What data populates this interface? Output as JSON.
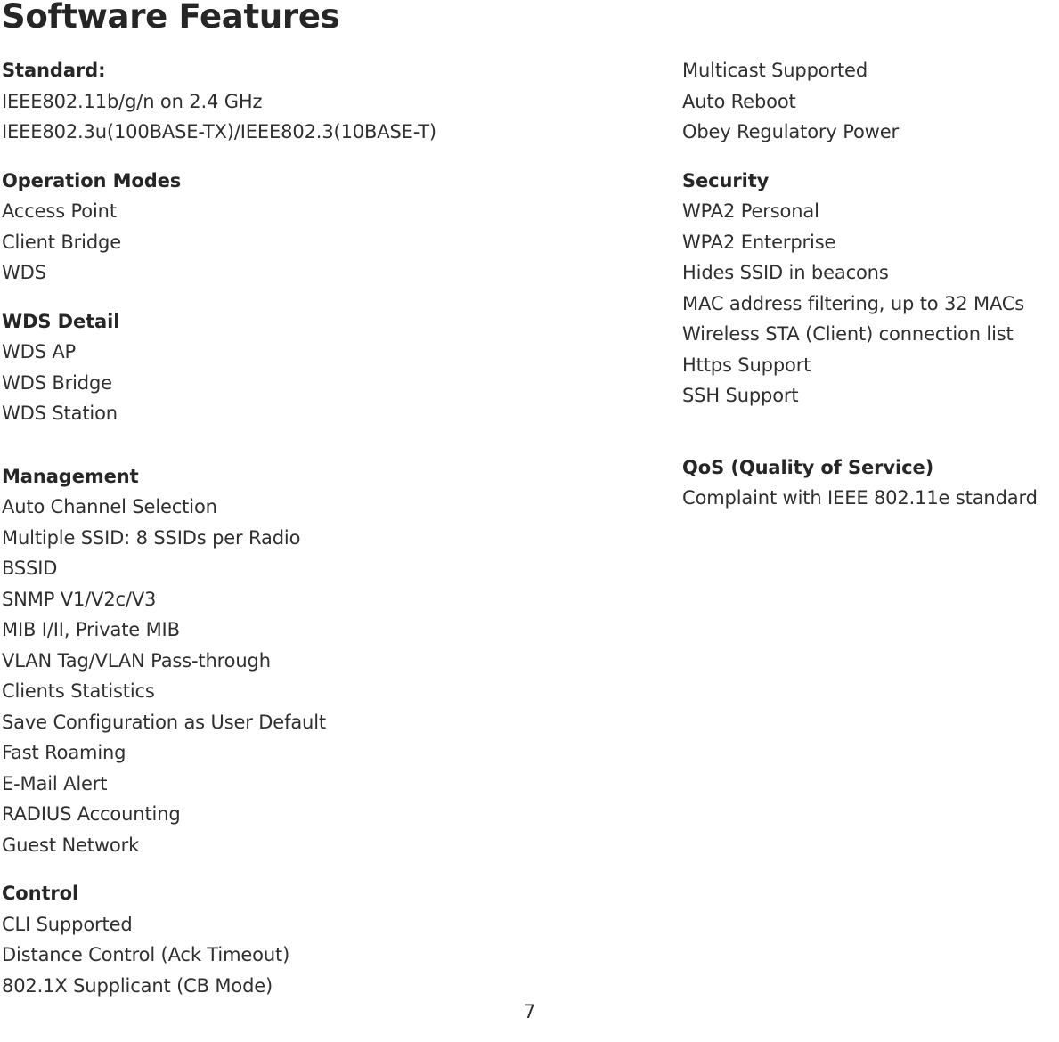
{
  "document": {
    "title": "Software Features",
    "page_number": "7"
  },
  "left_column": [
    {
      "heading": "Standard:",
      "items": [
        "IEEE802.11b/g/n on 2.4 GHz",
        "IEEE802.3u(100BASE-TX)/IEEE802.3(10BASE-T)"
      ],
      "spacing": "normal"
    },
    {
      "heading": "Operation Modes",
      "items": [
        "Access Point",
        "Client Bridge",
        "WDS"
      ],
      "spacing": "normal"
    },
    {
      "heading": "WDS Detail",
      "items": [
        "WDS AP",
        "WDS Bridge",
        "WDS Station"
      ],
      "spacing": "normal"
    },
    {
      "heading": "Management",
      "items": [
        "Auto Channel Selection",
        "Multiple SSID: 8 SSIDs per Radio",
        "BSSID",
        "SNMP V1/V2c/V3",
        "MIB I/II, Private MIB",
        "VLAN Tag/VLAN Pass-through",
        "Clients Statistics",
        "Save Configuration as User Default",
        "Fast Roaming",
        "E-Mail Alert",
        "RADIUS Accounting",
        "Guest Network"
      ],
      "spacing": "large"
    },
    {
      "heading": "Control",
      "items": [
        "CLI Supported",
        "Distance Control (Ack Timeout)",
        "802.1X Supplicant (CB Mode)"
      ],
      "spacing": "normal"
    }
  ],
  "right_column": [
    {
      "heading": "",
      "items": [
        "Multicast Supported",
        "Auto Reboot",
        "Obey Regulatory Power"
      ],
      "spacing": "normal"
    },
    {
      "heading": "Security",
      "items": [
        "WPA2 Personal",
        "WPA2 Enterprise",
        "Hides SSID in beacons",
        "MAC address filtering, up to 32 MACs",
        "Wireless STA (Client) connection list",
        "Https Support",
        "SSH Support"
      ],
      "spacing": "normal"
    },
    {
      "heading": "QoS (Quality of Service)",
      "items": [
        "Complaint with IEEE 802.11e standard"
      ],
      "spacing": "xl"
    }
  ]
}
